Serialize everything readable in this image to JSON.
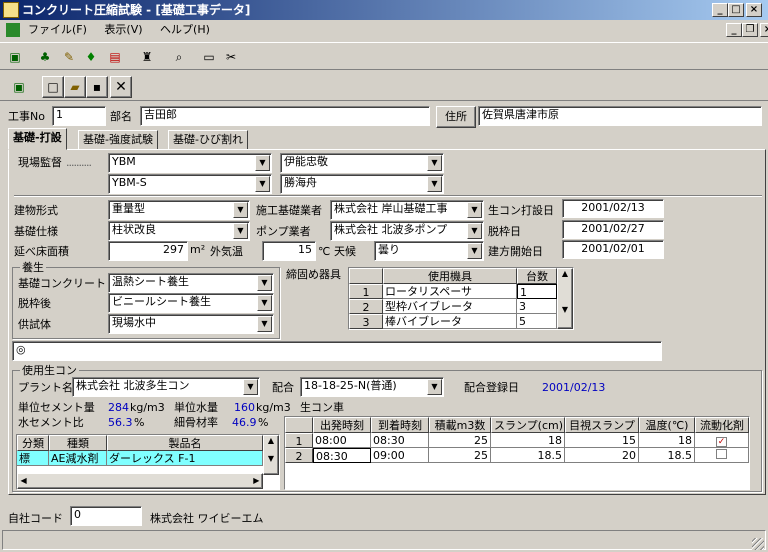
{
  "window": {
    "title": "コンクリート圧縮試験 - [基礎工事データ]"
  },
  "menu": {
    "file": "ファイル(F)",
    "view": "表示(V)",
    "help": "ヘルプ(H)"
  },
  "header": {
    "job_no_label": "工事No",
    "job_no": "1",
    "dept_label": "部名",
    "dept": "吉田郎",
    "address_button": "住所",
    "address": "佐賀県唐津市原"
  },
  "tabs": [
    "基礎-打設",
    "基礎-強度試験",
    "基礎-ひび割れ"
  ],
  "site": {
    "label": "現場監督",
    "sup1": "YBM",
    "name1": "伊能忠敬",
    "sup2": "YBM-S",
    "name2": "勝海舟"
  },
  "building": {
    "type_label": "建物形式",
    "type": "重量型",
    "spec_label": "基礎仕様",
    "spec": "柱状改良",
    "area_label": "延べ床面積",
    "area": "297",
    "area_unit": "m²",
    "temp_label": "外気温",
    "temp": "15",
    "temp_unit": "℃",
    "weather_label": "天候",
    "weather": "曇り"
  },
  "contractors": {
    "base_label": "施工基礎業者",
    "base": "株式会社 岸山基礎工事",
    "pump_label": "ポンプ業者",
    "pump": "株式会社 北波多ポンプ"
  },
  "dates": {
    "pour_label": "生コン打設日",
    "pour": "2001/02/13",
    "strip_label": "脱枠日",
    "strip": "2001/02/27",
    "start_label": "建方開始日",
    "start": "2001/02/01"
  },
  "curing": {
    "label": "養生",
    "base_label": "基礎コンクリート",
    "base": "温熱シート養生",
    "strip_label": "脱枠後",
    "strip": "ビニールシート養生",
    "spec_label": "供試体",
    "spec": "現場水中"
  },
  "tools": {
    "label": "締固め器具",
    "col_name": "使用機具",
    "col_count": "台数",
    "rows": [
      {
        "n": "1",
        "name": "ロータリスペーサ",
        "count": "1"
      },
      {
        "n": "2",
        "name": "型枠バイブレータ",
        "count": "3"
      },
      {
        "n": "3",
        "name": "棒バイブレータ",
        "count": "5"
      }
    ]
  },
  "memo": "◎",
  "ready": {
    "label": "使用生コン",
    "plant_label": "プラント名",
    "plant": "株式会社 北波多生コン",
    "mix_label": "配合",
    "mix": "18-18-25-N(普通)",
    "reg_label": "配合登録日",
    "reg": "2001/02/13",
    "cement_label": "単位セメント量",
    "cement": "284",
    "cement_unit": "kg/m3",
    "water_label": "単位水量",
    "water": "160",
    "water_unit": "kg/m3",
    "truck_label": "生コン車",
    "wc_label": "水セメント比",
    "wc": "56.3",
    "wc_unit": "%",
    "sand_label": "細骨材率",
    "sand": "46.9",
    "sand_unit": "%"
  },
  "admix": {
    "cols": [
      "分類",
      "種類",
      "製品名"
    ],
    "rows": [
      {
        "cls": "標",
        "kind": "AE減水剤",
        "product": "ダーレックス F-1"
      }
    ]
  },
  "trucks": {
    "cols": [
      "",
      "出発時刻",
      "到着時刻",
      "積載m3数",
      "スランプ(cm)",
      "目視スランプ",
      "温度(℃)",
      "流動化剤"
    ],
    "rows": [
      {
        "n": "1",
        "dep": "08:00",
        "arr": "08:30",
        "vol": "25",
        "slump": "18",
        "visual": "15",
        "temp": "18"
      },
      {
        "n": "2",
        "dep": "08:30",
        "arr": "09:00",
        "vol": "25",
        "slump": "18.5",
        "visual": "20",
        "temp": "18.5"
      }
    ]
  },
  "footer": {
    "code_label": "自社コード",
    "code": "0",
    "company": "株式会社 ワイビーエム"
  }
}
